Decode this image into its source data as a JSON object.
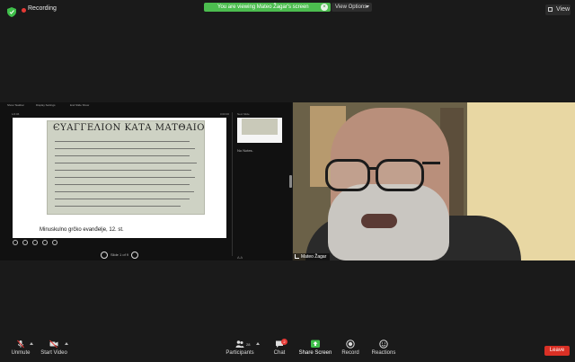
{
  "top": {
    "recording_label": "Recording",
    "viewing_banner": "You are viewing Mateo Žagar's screen",
    "view_options_label": "View Options",
    "view_label": "View"
  },
  "share": {
    "toolbar_items": [
      "Show Taskbar",
      "Display Settings",
      "End Slide Show"
    ],
    "slide_number_left": "1/2:06",
    "timer": "0:00:00",
    "manuscript_title": "ЄΥΑΓΓΕΛΙΟΝ ΚΑΤΑ ΜΑΤΘΑΙΟΝ",
    "caption": "Minuskulno grčko evanđelje, 12. st.",
    "slide_counter": "Slide 1 of 9",
    "next_slide_label": "Next Slide",
    "notes": "No Notes.",
    "side_icons": "A  A"
  },
  "video": {
    "participant_name": "Mateo Žagar"
  },
  "toolbar": {
    "unmute_label": "Unmute",
    "start_video_label": "Start Video",
    "participants_label": "Participants",
    "participants_count": "28",
    "chat_label": "Chat",
    "chat_badge": "2",
    "share_screen_label": "Share Screen",
    "record_label": "Record",
    "reactions_label": "Reactions",
    "leave_label": "Leave"
  },
  "colors": {
    "banner_green": "#4cbd4f",
    "leave_red": "#d93025",
    "share_green": "#3fbf4a",
    "recording_red": "#e53935"
  }
}
